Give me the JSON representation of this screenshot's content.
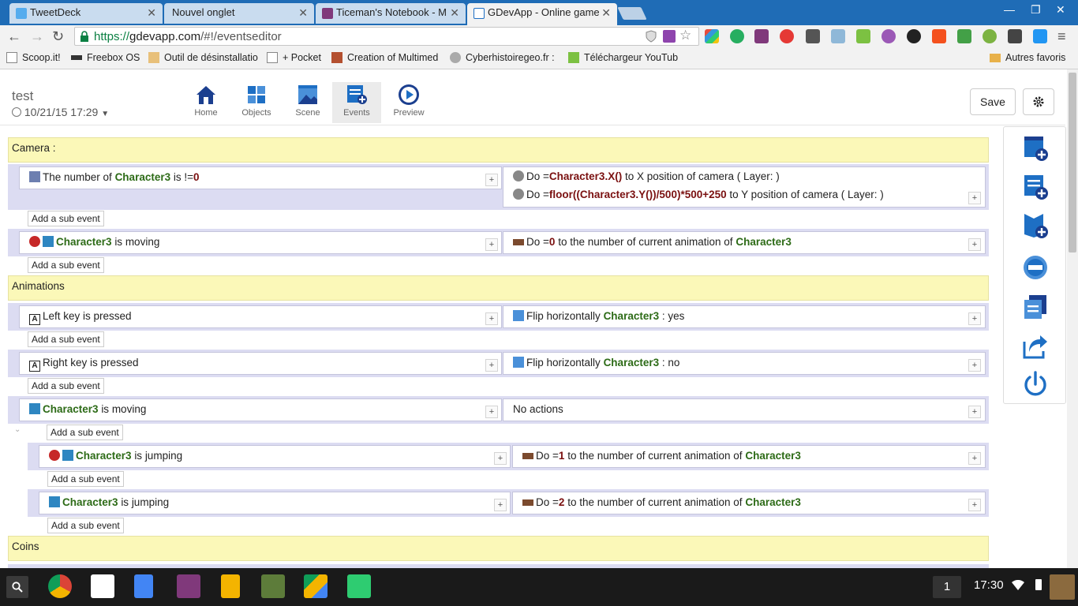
{
  "browser": {
    "tabs": [
      {
        "title": "TweetDeck",
        "active": false
      },
      {
        "title": "Nouvel onglet",
        "active": false
      },
      {
        "title": "Ticeman's Notebook - M",
        "active": false
      },
      {
        "title": "GDevApp - Online game",
        "active": true
      }
    ],
    "url_scheme": "https://",
    "url_host": "gdevapp.com",
    "url_path": "/#!/eventseditor",
    "bookmarks": [
      "Scoop.it!",
      "Freebox OS",
      "Outil de désinstallatio",
      "+ Pocket",
      "Creation of Multimed",
      "Cyberhistoiregeo.fr :",
      "Téléchargeur YouTub",
      "Autres favoris"
    ]
  },
  "app": {
    "project_name": "test",
    "project_date": "10/21/15 17:29",
    "nav": [
      {
        "label": "Home",
        "icon": "home-icon"
      },
      {
        "label": "Objects",
        "icon": "objects-icon"
      },
      {
        "label": "Scene",
        "icon": "scene-icon"
      },
      {
        "label": "Events",
        "icon": "events-icon",
        "active": true
      },
      {
        "label": "Preview",
        "icon": "play-icon"
      }
    ],
    "save_label": "Save",
    "add_sub_event": "Add a sub event",
    "plus": "+"
  },
  "events": {
    "g_camera": "Camera :",
    "g_animations": "Animations",
    "g_coins": "Coins",
    "e1_c1": "The number of",
    "e1_c2": "Character3",
    "e1_c3": "is !=",
    "e1_c4": "0",
    "e1_a1_1": "Do =",
    "e1_a1_2": "Character3.X()",
    "e1_a1_3": "to X position of camera ( Layer: )",
    "e1_a2_1": "Do =",
    "e1_a2_2": "floor((Character3.Y())/500)*500+250",
    "e1_a2_3": "to Y position of camera ( Layer: )",
    "e2_c1": "Character3",
    "e2_c2": "is moving",
    "e2_a1": "Do =",
    "e2_a2": "0",
    "e2_a3": "to the number of current animation of",
    "e2_a4": "Character3",
    "e3_c": "Left key is pressed",
    "e3_a1": "Flip horizontally",
    "e3_a2": "Character3",
    "e3_a3": ": yes",
    "e4_c": "Right key is pressed",
    "e4_a1": "Flip horizontally",
    "e4_a2": "Character3",
    "e4_a3": ": no",
    "e5_c1": "Character3",
    "e5_c2": "is moving",
    "e5_a": "No actions",
    "e6_c1": "Character3",
    "e6_c2": "is jumping",
    "e6_a1": "Do =",
    "e6_a2": "1",
    "e6_a3": "to the number of current animation of",
    "e6_a4": "Character3",
    "e7_c1": "Character3",
    "e7_c2": "is jumping",
    "e7_a1": "Do =",
    "e7_a2": "2",
    "e7_a3": "to the number of current animation of",
    "e7_a4": "Character3"
  },
  "taskbar": {
    "badge": "1",
    "clock": "17:30"
  },
  "colors": {
    "group_bg": "#fbf8b8",
    "event_bg": "#dcdcf2",
    "object_name": "#2d6b17",
    "value": "#7a1010",
    "tabstrip": "#1f6cb6",
    "icon_blue": "#1e6fc4"
  }
}
